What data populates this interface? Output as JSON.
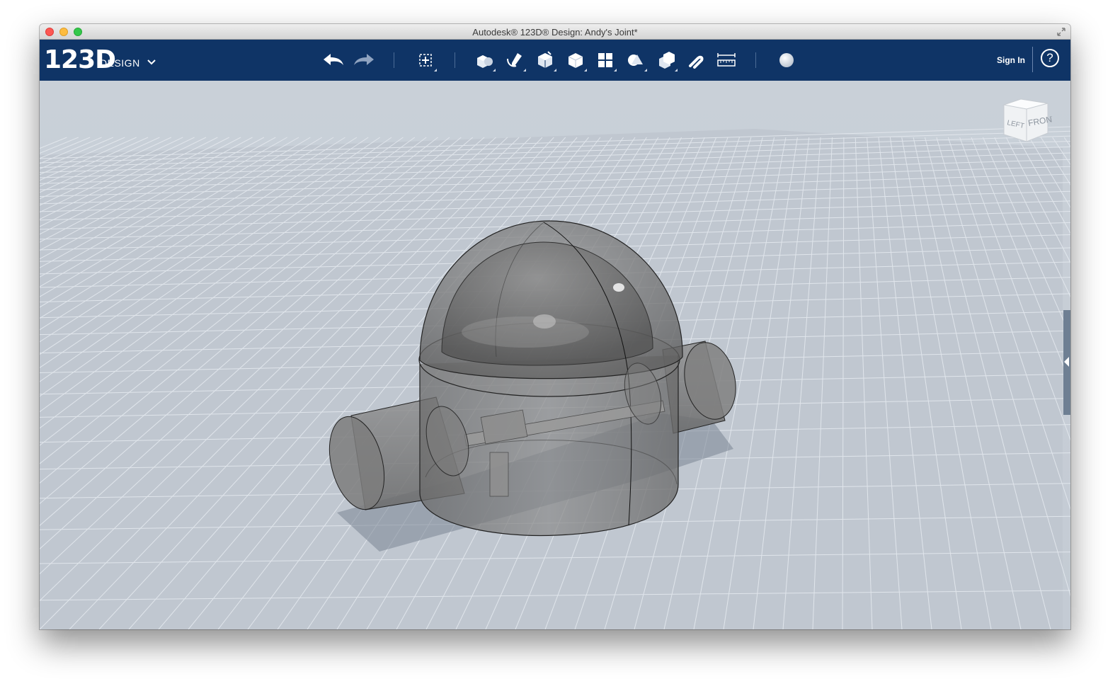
{
  "window": {
    "title": "Autodesk® 123D® Design: Andy's Joint*"
  },
  "app": {
    "logo_number": "123D",
    "logo_word": "DESIGN"
  },
  "toolbar": {
    "tools": [
      {
        "name": "undo",
        "icon": "undo-arrow-icon"
      },
      {
        "name": "redo",
        "icon": "redo-arrow-icon"
      },
      {
        "name": "transform",
        "icon": "transform-icon"
      },
      {
        "name": "primitives",
        "icon": "primitives-icon"
      },
      {
        "name": "sketch",
        "icon": "sketch-icon"
      },
      {
        "name": "construct",
        "icon": "construct-icon"
      },
      {
        "name": "modify",
        "icon": "modify-icon"
      },
      {
        "name": "pattern",
        "icon": "pattern-icon"
      },
      {
        "name": "grouping",
        "icon": "grouping-icon"
      },
      {
        "name": "combine",
        "icon": "combine-icon"
      },
      {
        "name": "snap",
        "icon": "snap-icon"
      },
      {
        "name": "measure",
        "icon": "measure-icon"
      },
      {
        "name": "material",
        "icon": "material-sphere-icon"
      }
    ],
    "sign_in_label": "Sign In",
    "help_label": "?"
  },
  "view_cube": {
    "left_label": "LEFT",
    "front_label": "FRONT"
  },
  "colors": {
    "toolbar_bg": "#0f3466",
    "viewport_bg": "#c3cad3",
    "grid_line": "#e6ebf1",
    "model_fill": "#6f6f6f"
  }
}
